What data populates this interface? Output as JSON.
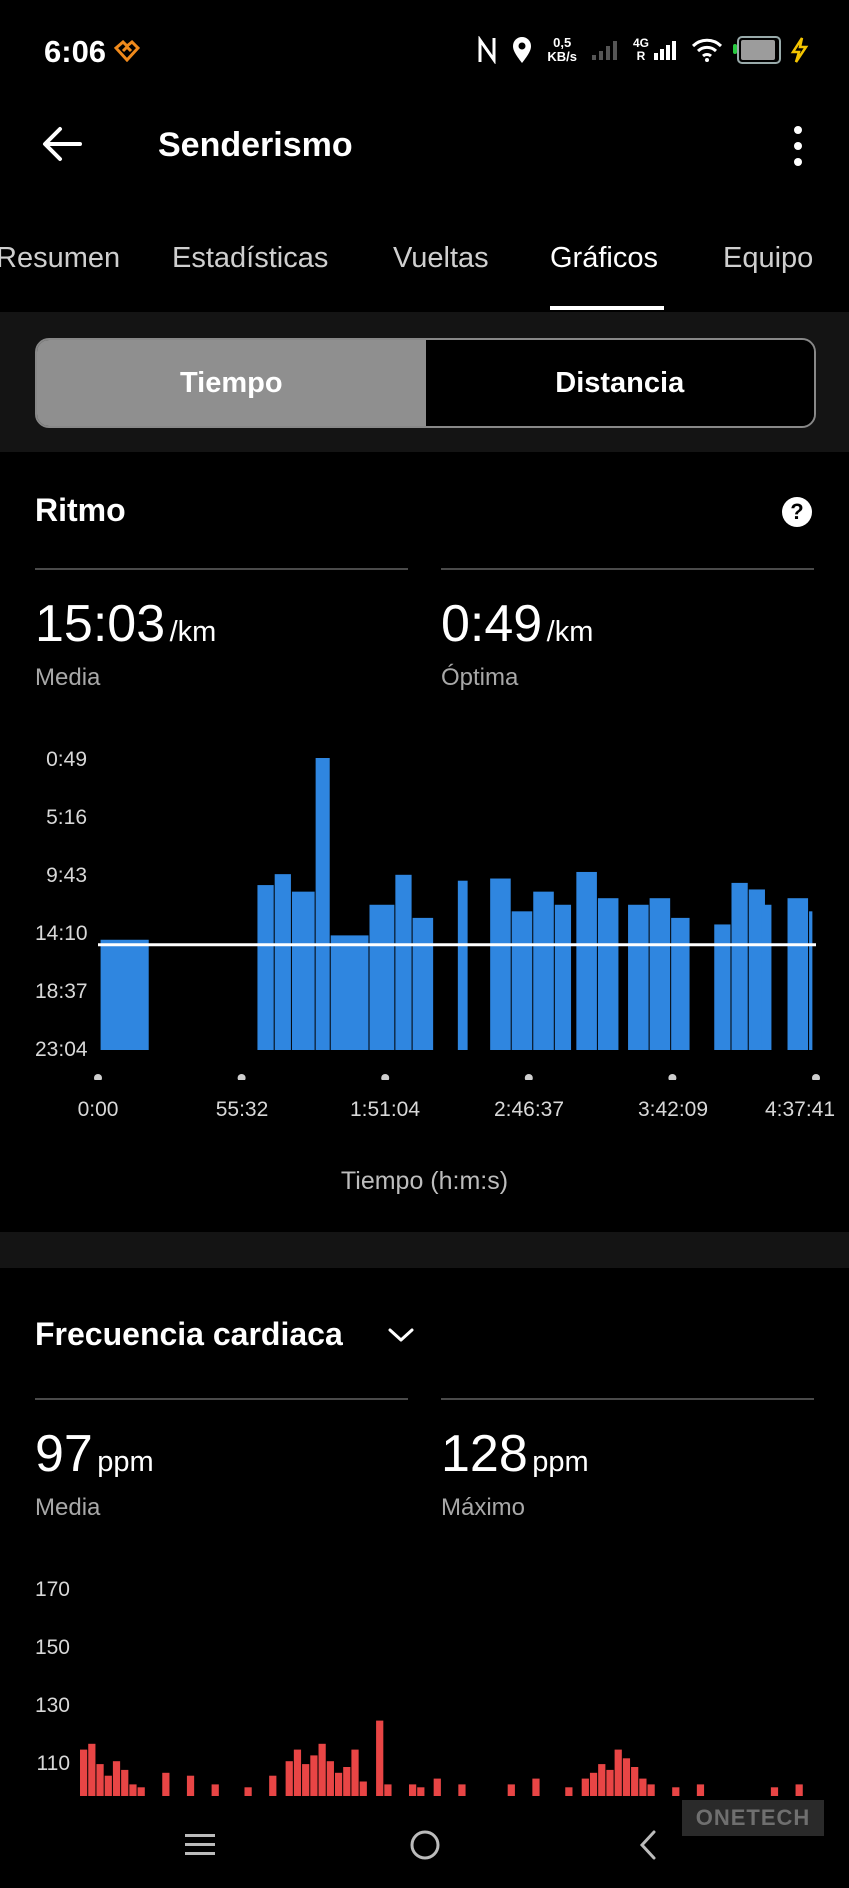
{
  "status": {
    "time": "6:06",
    "net_speed_value": "0,5",
    "net_speed_unit": "KB/s",
    "network_type": "4G",
    "roaming": "R",
    "icons": [
      "nfc-icon",
      "location-icon",
      "signal-icon",
      "wifi-icon",
      "battery-icon",
      "charging-icon"
    ],
    "battery_level": 0.85
  },
  "header": {
    "title": "Senderismo"
  },
  "tabs": [
    {
      "label": "Resumen",
      "active": false
    },
    {
      "label": "Estadísticas",
      "active": false
    },
    {
      "label": "Vueltas",
      "active": false
    },
    {
      "label": "Gráficos",
      "active": true
    },
    {
      "label": "Equipo",
      "active": false
    }
  ],
  "segmented": {
    "options": [
      "Tiempo",
      "Distancia"
    ],
    "selected": "Tiempo"
  },
  "pace": {
    "title": "Ritmo",
    "avg_value": "15:03",
    "avg_unit": "/km",
    "avg_label": "Media",
    "best_value": "0:49",
    "best_unit": "/km",
    "best_label": "Óptima",
    "xlabel": "Tiempo (h:m:s)"
  },
  "heart": {
    "title": "Frecuencia cardiaca",
    "avg_value": "97",
    "avg_unit": "ppm",
    "avg_label": "Media",
    "max_value": "128",
    "max_unit": "ppm",
    "max_label": "Máximo"
  },
  "watermark": "ONETECH",
  "colors": {
    "pace_bar": "#2f86e0",
    "heart_bar": "#e84545",
    "avg_line": "#ffffff"
  },
  "chart_data": [
    {
      "type": "bar",
      "title": "Ritmo",
      "xlabel": "Tiempo (h:m:s)",
      "ylabel": "",
      "x_ticks": [
        "0:00",
        "55:32",
        "1:51:04",
        "2:46:37",
        "3:42:09",
        "4:37:41"
      ],
      "y_ticks": [
        "0:49",
        "5:16",
        "9:43",
        "14:10",
        "18:37",
        "23:04"
      ],
      "y_range_seconds": [
        49,
        1384
      ],
      "y_inverted": true,
      "x_range_seconds": [
        0,
        16661
      ],
      "average_line": "15:03",
      "segments": [
        {
          "start": 60,
          "end": 1200,
          "top": "14:40"
        },
        {
          "start": 3700,
          "end": 4100,
          "top": "10:30"
        },
        {
          "start": 4100,
          "end": 4500,
          "top": "9:40"
        },
        {
          "start": 4500,
          "end": 5050,
          "top": "11:00"
        },
        {
          "start": 5050,
          "end": 5400,
          "top": "0:49"
        },
        {
          "start": 5400,
          "end": 6300,
          "top": "14:20"
        },
        {
          "start": 6300,
          "end": 6900,
          "top": "12:00"
        },
        {
          "start": 6900,
          "end": 7300,
          "top": "9:43"
        },
        {
          "start": 7300,
          "end": 7800,
          "top": "13:00"
        },
        {
          "start": 8350,
          "end": 8600,
          "top": "10:10"
        },
        {
          "start": 9100,
          "end": 9600,
          "top": "10:00"
        },
        {
          "start": 9600,
          "end": 10100,
          "top": "12:30"
        },
        {
          "start": 10100,
          "end": 10600,
          "top": "11:00"
        },
        {
          "start": 10600,
          "end": 11000,
          "top": "12:00"
        },
        {
          "start": 11100,
          "end": 11600,
          "top": "9:30"
        },
        {
          "start": 11600,
          "end": 12100,
          "top": "11:30"
        },
        {
          "start": 12300,
          "end": 12800,
          "top": "12:00"
        },
        {
          "start": 12800,
          "end": 13300,
          "top": "11:30"
        },
        {
          "start": 13300,
          "end": 13750,
          "top": "13:00"
        },
        {
          "start": 14300,
          "end": 14700,
          "top": "13:30"
        },
        {
          "start": 14700,
          "end": 15100,
          "top": "10:20"
        },
        {
          "start": 15100,
          "end": 15500,
          "top": "10:50"
        },
        {
          "start": 15400,
          "end": 15650,
          "top": "12:00"
        },
        {
          "start": 16000,
          "end": 16500,
          "top": "11:30"
        },
        {
          "start": 16500,
          "end": 16600,
          "top": "12:30"
        }
      ]
    },
    {
      "type": "bar",
      "title": "Frecuencia cardiaca",
      "xlabel": "",
      "ylabel": "",
      "y_ticks": [
        "170",
        "150",
        "130",
        "110"
      ],
      "y_range": [
        100,
        170
      ],
      "values": [
        116,
        118,
        111,
        107,
        112,
        109,
        104,
        103,
        100,
        100,
        108,
        100,
        100,
        107,
        100,
        100,
        104,
        100,
        100,
        100,
        103,
        100,
        100,
        107,
        100,
        112,
        116,
        111,
        114,
        118,
        112,
        108,
        110,
        116,
        105,
        100,
        126,
        104,
        100,
        100,
        104,
        103,
        100,
        106,
        100,
        100,
        104,
        100,
        100,
        100,
        100,
        100,
        104,
        100,
        100,
        106,
        100,
        100,
        100,
        103,
        100,
        106,
        108,
        111,
        109,
        116,
        113,
        110,
        106,
        104,
        100,
        100,
        103,
        100,
        100,
        104,
        100,
        100,
        100,
        100,
        100,
        100,
        100,
        100,
        103,
        100,
        100,
        104,
        100
      ]
    }
  ]
}
